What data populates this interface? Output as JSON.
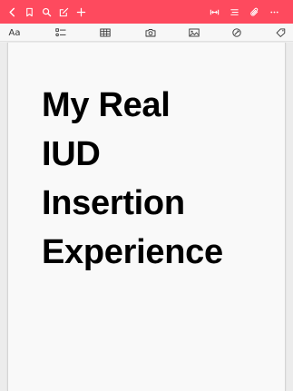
{
  "colors": {
    "accent": "#fe4a5e",
    "toolbar_bg": "#f7f7f7",
    "page_bg": "#f9f9f9"
  },
  "top_toolbar": {
    "left_icons": [
      "back-icon",
      "bookmark-icon",
      "search-icon",
      "compose-icon",
      "add-icon"
    ],
    "right_icons": [
      "fit-width-icon",
      "outline-icon",
      "attachment-icon",
      "more-icon"
    ]
  },
  "format_toolbar": {
    "text_style_label": "Aa",
    "icons": [
      "checklist-icon",
      "table-icon",
      "camera-icon",
      "image-icon",
      "drawing-icon",
      "tag-icon"
    ]
  },
  "note": {
    "title_lines": [
      "My Real",
      "IUD",
      "Insertion",
      "Experience"
    ]
  }
}
